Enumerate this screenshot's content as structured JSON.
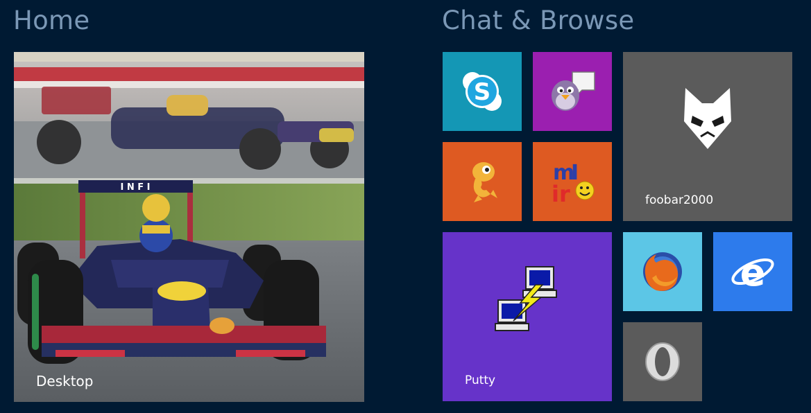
{
  "groups": {
    "home": {
      "title": "Home"
    },
    "chat": {
      "title": "Chat & Browse"
    }
  },
  "tiles": {
    "desktop": {
      "label": "Desktop",
      "icon": "f1-race-car-photo"
    },
    "skype": {
      "icon": "skype-icon",
      "color": "#1497b5"
    },
    "pidgin": {
      "icon": "pidgin-icon",
      "color": "#9b1fb0"
    },
    "foobar": {
      "label": "foobar2000",
      "icon": "foobar-fox-icon",
      "color": "#5b5b5b"
    },
    "trillian": {
      "icon": "dino-icon",
      "color": "#de5a22"
    },
    "mirc": {
      "icon": "mirc-icon",
      "color": "#de5a22"
    },
    "putty": {
      "label": "Putty",
      "icon": "putty-icon",
      "color": "#6633c9"
    },
    "firefox": {
      "icon": "firefox-icon",
      "color": "#5cc6e6"
    },
    "ie": {
      "icon": "internet-explorer-icon",
      "color": "#2d7bec"
    },
    "opera": {
      "icon": "opera-icon",
      "color": "#5b5b5b"
    }
  }
}
